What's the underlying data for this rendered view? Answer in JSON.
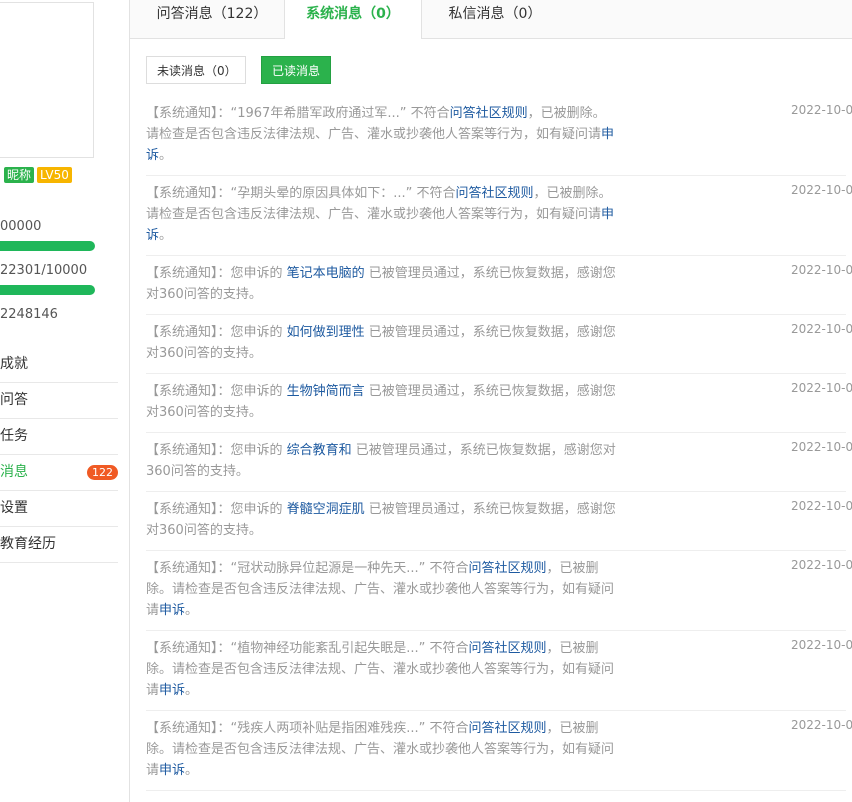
{
  "sidebar": {
    "badges": [
      "昵称",
      "LV50"
    ],
    "stats": [
      "00000",
      "22301/10000",
      "2248146"
    ],
    "menu": [
      {
        "label": "成就"
      },
      {
        "label": "问答"
      },
      {
        "label": "任务"
      },
      {
        "label": "消息",
        "count": "122"
      },
      {
        "label": "设置"
      },
      {
        "label": "教育经历"
      }
    ]
  },
  "tabs": [
    {
      "label": "问答消息（122）"
    },
    {
      "label": "系统消息（0）"
    },
    {
      "label": "私信消息（0）"
    }
  ],
  "filters": {
    "unread": "未读消息（0）",
    "read": "已读消息"
  },
  "messages": [
    {
      "parts": [
        {
          "t": "【系统通知】：“1967年希腊军政府通过军...” 不符合"
        },
        {
          "t": "问答社区规则",
          "l": true
        },
        {
          "t": "，已被删除。请检查是否包含违反法律法规、广告、灌水或抄袭他人答案等行为，如有疑问请"
        },
        {
          "t": "申诉",
          "l": true
        },
        {
          "t": "。"
        }
      ],
      "date": "2022-10-0"
    },
    {
      "parts": [
        {
          "t": "【系统通知】：“孕期头晕的原因具体如下：...” 不符合"
        },
        {
          "t": "问答社区规则",
          "l": true
        },
        {
          "t": "，已被删除。请检查是否包含违反法律法规、广告、灌水或抄袭他人答案等行为，如有疑问请"
        },
        {
          "t": "申诉",
          "l": true
        },
        {
          "t": "。"
        }
      ],
      "date": "2022-10-0"
    },
    {
      "parts": [
        {
          "t": "【系统通知】：您申诉的 "
        },
        {
          "t": "笔记本电脑的",
          "l": true
        },
        {
          "t": " 已被管理员通过，系统已恢复数据，感谢您对360问答的支持。"
        }
      ],
      "date": "2022-10-0"
    },
    {
      "parts": [
        {
          "t": "【系统通知】：您申诉的 "
        },
        {
          "t": "如何做到理性",
          "l": true
        },
        {
          "t": " 已被管理员通过，系统已恢复数据，感谢您对360问答的支持。"
        }
      ],
      "date": "2022-10-0"
    },
    {
      "parts": [
        {
          "t": "【系统通知】：您申诉的 "
        },
        {
          "t": "生物钟简而言",
          "l": true
        },
        {
          "t": " 已被管理员通过，系统已恢复数据，感谢您对360问答的支持。"
        }
      ],
      "date": "2022-10-0"
    },
    {
      "parts": [
        {
          "t": "【系统通知】：您申诉的 "
        },
        {
          "t": "  综合教育和",
          "l": true
        },
        {
          "t": " 已被管理员通过，系统已恢复数据，感谢您对360问答的支持。"
        }
      ],
      "date": "2022-10-0"
    },
    {
      "parts": [
        {
          "t": "【系统通知】：您申诉的 "
        },
        {
          "t": "脊髓空洞症肌",
          "l": true
        },
        {
          "t": " 已被管理员通过，系统已恢复数据，感谢您对360问答的支持。"
        }
      ],
      "date": "2022-10-0"
    },
    {
      "parts": [
        {
          "t": "【系统通知】：“冠状动脉异位起源是一种先天...” 不符合"
        },
        {
          "t": "问答社区规则",
          "l": true
        },
        {
          "t": "，已被删除。请检查是否包含违反法律法规、广告、灌水或抄袭他人答案等行为，如有疑问请"
        },
        {
          "t": "申诉",
          "l": true
        },
        {
          "t": "。"
        }
      ],
      "date": "2022-10-0"
    },
    {
      "parts": [
        {
          "t": "【系统通知】：“植物神经功能紊乱引起失眠是...” 不符合"
        },
        {
          "t": "问答社区规则",
          "l": true
        },
        {
          "t": "，已被删除。请检查是否包含违反法律法规、广告、灌水或抄袭他人答案等行为，如有疑问请"
        },
        {
          "t": "申诉",
          "l": true
        },
        {
          "t": "。"
        }
      ],
      "date": "2022-10-0"
    },
    {
      "parts": [
        {
          "t": "【系统通知】：“残疾人两项补贴是指困难残疾...” 不符合"
        },
        {
          "t": "问答社区规则",
          "l": true
        },
        {
          "t": "，已被删除。请检查是否包含违反法律法规、广告、灌水或抄袭他人答案等行为，如有疑问请"
        },
        {
          "t": "申诉",
          "l": true
        },
        {
          "t": "。"
        }
      ],
      "date": "2022-10-0"
    }
  ]
}
